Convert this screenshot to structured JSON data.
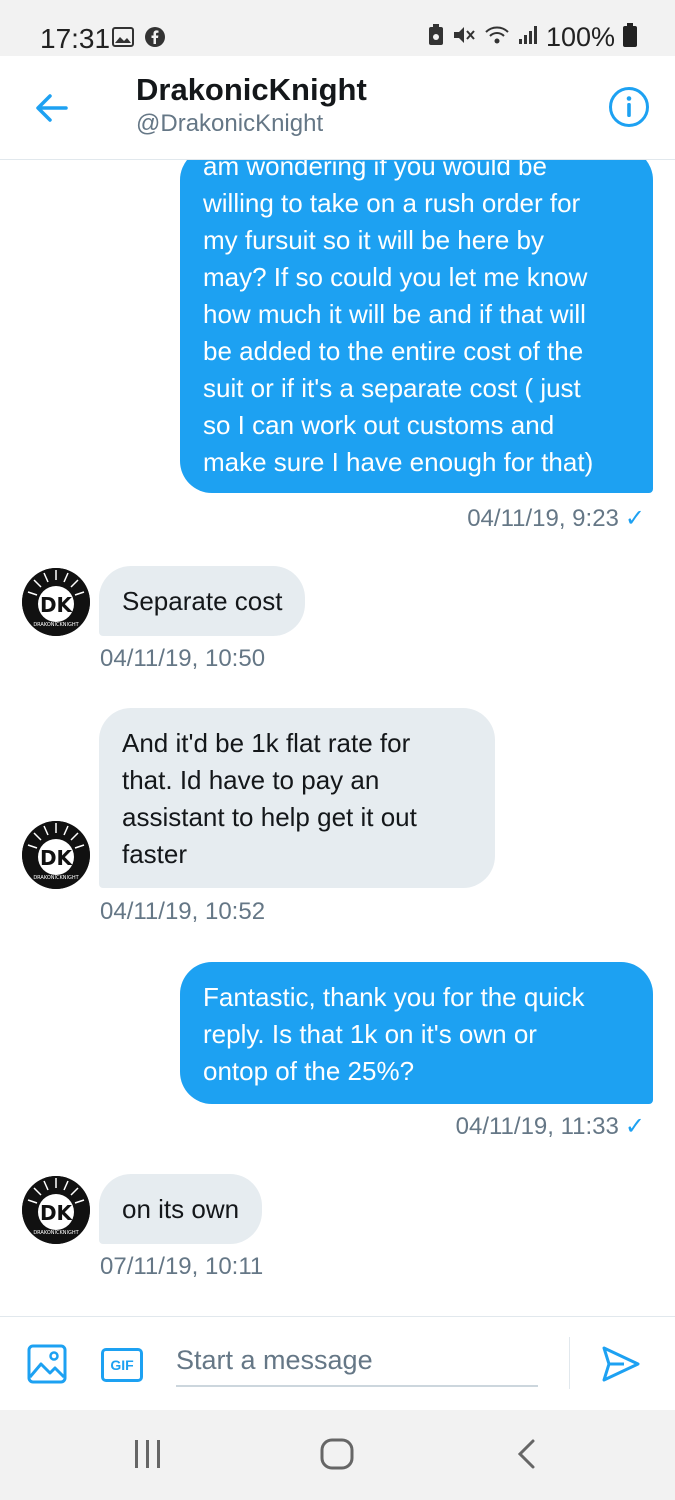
{
  "status_bar": {
    "time": "17:31",
    "battery": "100%",
    "left_icons": [
      "gallery-icon",
      "facebook-icon"
    ],
    "right_icons": [
      "battery-saver-icon",
      "mute-icon",
      "wifi-icon",
      "signal-icon",
      "battery-icon"
    ]
  },
  "header": {
    "name": "DrakonicKnight",
    "handle": "@DrakonicKnight"
  },
  "avatar": {
    "initials": "DK",
    "caption": "DRAKONICKNIGHT"
  },
  "messages": [
    {
      "direction": "out",
      "lines": [
        "am wondering if you would be",
        "willing to take on  a rush order for",
        "my fursuit so it will be here by",
        "may? If so could you let me know",
        "how much it will be and if that will",
        "be added to the entire cost of the",
        "suit or if it's a separate cost ( just",
        "so I can work out customs and",
        "make sure I have enough for that)"
      ],
      "timestamp": "04/11/19, 9:23",
      "read": "✓"
    },
    {
      "direction": "in",
      "lines": [
        "Separate cost"
      ],
      "timestamp": "04/11/19, 10:50"
    },
    {
      "direction": "in",
      "lines": [
        "And it'd be 1k flat rate for",
        "that. Id have to pay an",
        "assistant to help get it out",
        "faster"
      ],
      "timestamp": "04/11/19, 10:52"
    },
    {
      "direction": "out",
      "lines": [
        "Fantastic,  thank you for the quick",
        "reply.  Is that 1k on it's own or",
        "ontop of the 25%?"
      ],
      "timestamp": "04/11/19, 11:33",
      "read": "✓"
    },
    {
      "direction": "in",
      "lines": [
        "on its own"
      ],
      "timestamp": "07/11/19, 10:11"
    }
  ],
  "composer": {
    "placeholder": "Start a message",
    "gif_label": "GIF"
  },
  "colors": {
    "accent": "#1da1f2",
    "incoming_bubble": "#e6ecf0",
    "muted_text": "#657786"
  }
}
